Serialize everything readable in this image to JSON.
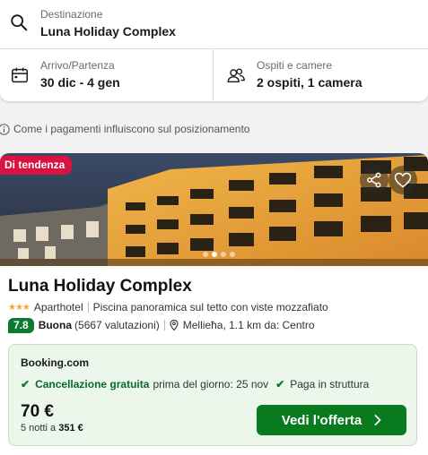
{
  "search": {
    "destination_label": "Destinazione",
    "destination_value": "Luna Holiday Complex",
    "dates_label": "Arrivo/Partenza",
    "dates_value": "30 dic - 4 gen",
    "guests_label": "Ospiti e camere",
    "guests_value": "2 ospiti, 1 camera",
    "icons": [
      "search-icon",
      "calendar-icon",
      "people-icon"
    ]
  },
  "payment_info": {
    "text": "Come i pagamenti influiscono sul posizionamento",
    "icon": "info-icon"
  },
  "hotel": {
    "badge": "Di tendenza",
    "name": "Luna Holiday Complex",
    "star_count": 3,
    "stars": "★★★",
    "type": "Aparthotel",
    "highlight": "Piscina panoramica sul tetto con viste mozzafiato",
    "score": "7.8",
    "rating_word": "Buona",
    "reviews": "(5667 valutazioni)",
    "location": "Mellieħa, 1.1 km da: Centro",
    "image_count": 4,
    "active_image": 1
  },
  "offer": {
    "provider": "Booking.com",
    "perk1_strong": "Cancellazione gratuita",
    "perk1_rest": "prima del giorno: 25 nov",
    "perk2": "Paga in struttura",
    "price": "70 €",
    "nights": "5 notti a",
    "total": "351 €",
    "cta": "Vedi l'offerta"
  },
  "colors": {
    "badge": "#d9123f",
    "score": "#0a7a2f",
    "offer_bg": "#ebf7ea",
    "cta": "#0a7a1f",
    "stars": "#f5a623"
  }
}
